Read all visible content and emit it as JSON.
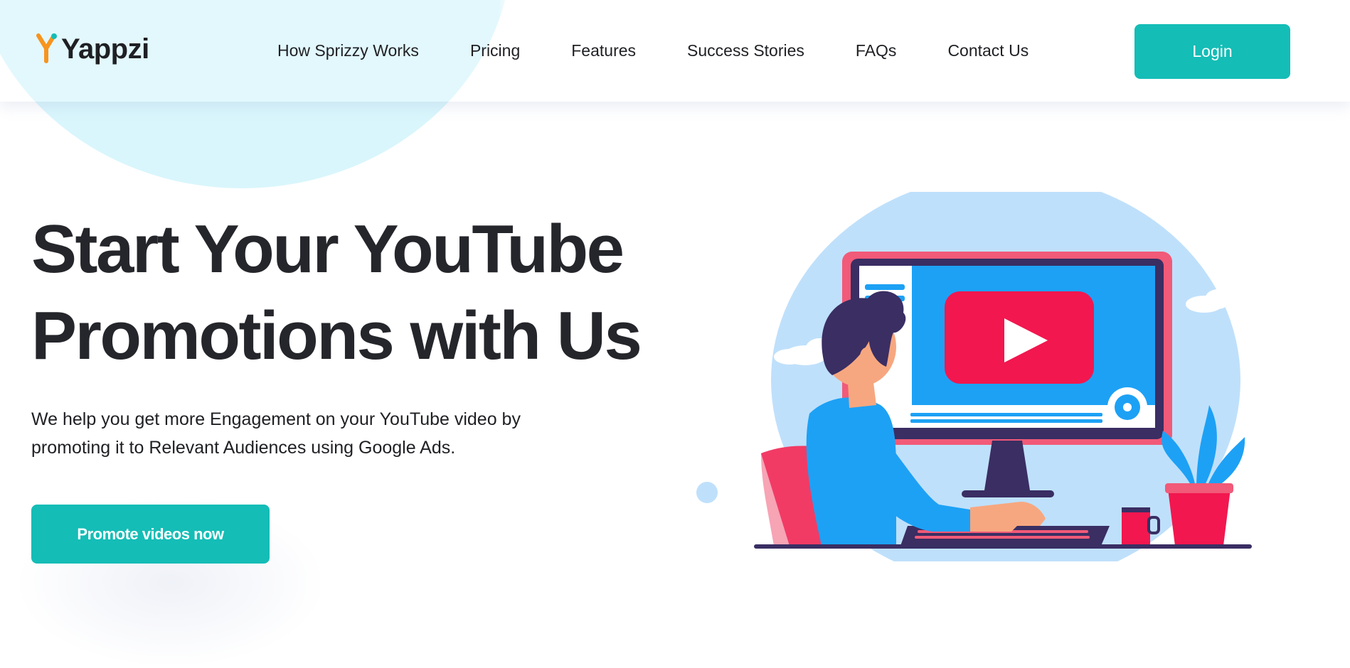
{
  "brand": {
    "name": "Yappzi",
    "logo_icon": "yappzi-y-logo-icon"
  },
  "nav": {
    "items": [
      {
        "label": "How Sprizzy Works"
      },
      {
        "label": "Pricing"
      },
      {
        "label": "Features"
      },
      {
        "label": "Success Stories"
      },
      {
        "label": "FAQs"
      },
      {
        "label": "Contact Us"
      }
    ],
    "login_label": "Login"
  },
  "hero": {
    "title_line1": "Start Your YouTube",
    "title_line2": "Promotions with Us",
    "subtitle": "We help you get more Engagement on your YouTube video by promoting it to Relevant Audiences using Google Ads.",
    "cta_label": "Promote videos now",
    "illustration": "person-watching-youtube-on-monitor-illustration"
  },
  "colors": {
    "accent": "#14bdb6",
    "heading": "#25262b",
    "blob": "#d9f6fc",
    "youtube_red": "#f2174f",
    "screen_blue": "#1da1f5"
  }
}
